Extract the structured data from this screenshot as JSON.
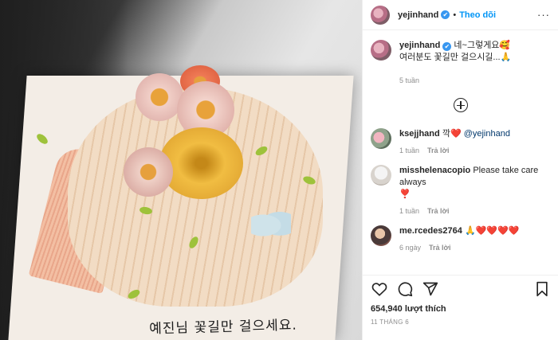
{
  "post": {
    "cake_message": "예진님 꽃길만 걸으세요."
  },
  "header": {
    "username": "yejinhand",
    "verified_glyph": "✔",
    "separator": "•",
    "follow_label": "Theo dõi",
    "more_glyph": "···"
  },
  "caption": {
    "username": "yejinhand",
    "line1": "네~그렇게요🥰",
    "line2": "여러분도 꽃길만 걸으시길...🙏",
    "time": "5 tuần"
  },
  "comments": [
    {
      "username": "ksejjhand",
      "text_pre": "깍",
      "heart": "❤️",
      "mention": "@yejinhand",
      "text_post": "",
      "time": "1 tuần",
      "reply": "Trả lời"
    },
    {
      "username": "misshelenacopio",
      "text_pre": "Please take care always",
      "heart": "❣️",
      "mention": "",
      "text_post": "",
      "time": "1 tuần",
      "reply": "Trả lời"
    },
    {
      "username": "me.rcedes2764",
      "text_pre": "🙏",
      "heart": "❤️❤️❤️❤️",
      "mention": "",
      "text_post": "",
      "time": "6 ngày",
      "reply": "Trả lời"
    }
  ],
  "actions": {
    "likes": "654,940 lượt thích",
    "date": "11 THÁNG 6"
  },
  "icons": {
    "load_more": "plus-circle-icon",
    "like": "heart-icon",
    "comment": "comment-icon",
    "share": "share-icon",
    "save": "bookmark-icon"
  }
}
